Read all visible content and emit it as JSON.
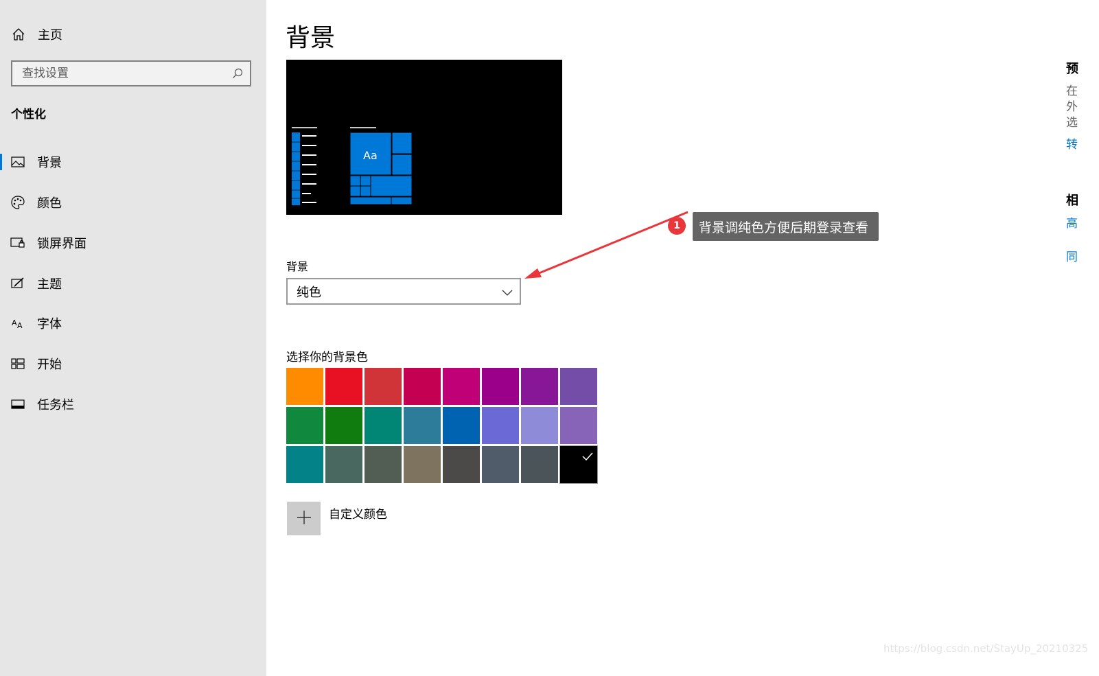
{
  "sidebar": {
    "home_label": "主页",
    "search_placeholder": "查找设置",
    "section_title": "个性化",
    "items": [
      {
        "label": "背景"
      },
      {
        "label": "颜色"
      },
      {
        "label": "锁屏界面"
      },
      {
        "label": "主题"
      },
      {
        "label": "字体"
      },
      {
        "label": "开始"
      },
      {
        "label": "任务栏"
      }
    ]
  },
  "main": {
    "title": "背景",
    "preview_tile_text": "Aa",
    "background_label": "背景",
    "background_value": "纯色",
    "choose_color_label": "选择你的背景色",
    "swatches": [
      "#ff8c00",
      "#e81123",
      "#d13438",
      "#c30052",
      "#bf0077",
      "#9a0089",
      "#881798",
      "#744da9",
      "#10893e",
      "#107c10",
      "#018574",
      "#2d7d9a",
      "#0063b1",
      "#6b69d6",
      "#8e8cd8",
      "#8764b8",
      "#038387",
      "#486860",
      "#525e54",
      "#7e735f",
      "#4c4a48",
      "#515c6b",
      "#4a5459",
      "#000000"
    ],
    "selected_swatch": "#000000",
    "custom_color_label": "自定义颜色"
  },
  "annotation": {
    "number": "1",
    "text": "背景调纯色方便后期登录查看"
  },
  "right_column": {
    "line1": "预",
    "line2": "在",
    "line3": "外",
    "line4": "选",
    "link1": "转",
    "line5": "相",
    "link2": "高",
    "link3": "同"
  },
  "watermark": "https://blog.csdn.net/StayUp_20210325",
  "colors": {
    "sidebar_bg": "#e6e6e6",
    "accent": "#0078d7",
    "annotation_red": "#e8363b",
    "annotation_box": "#646464"
  }
}
